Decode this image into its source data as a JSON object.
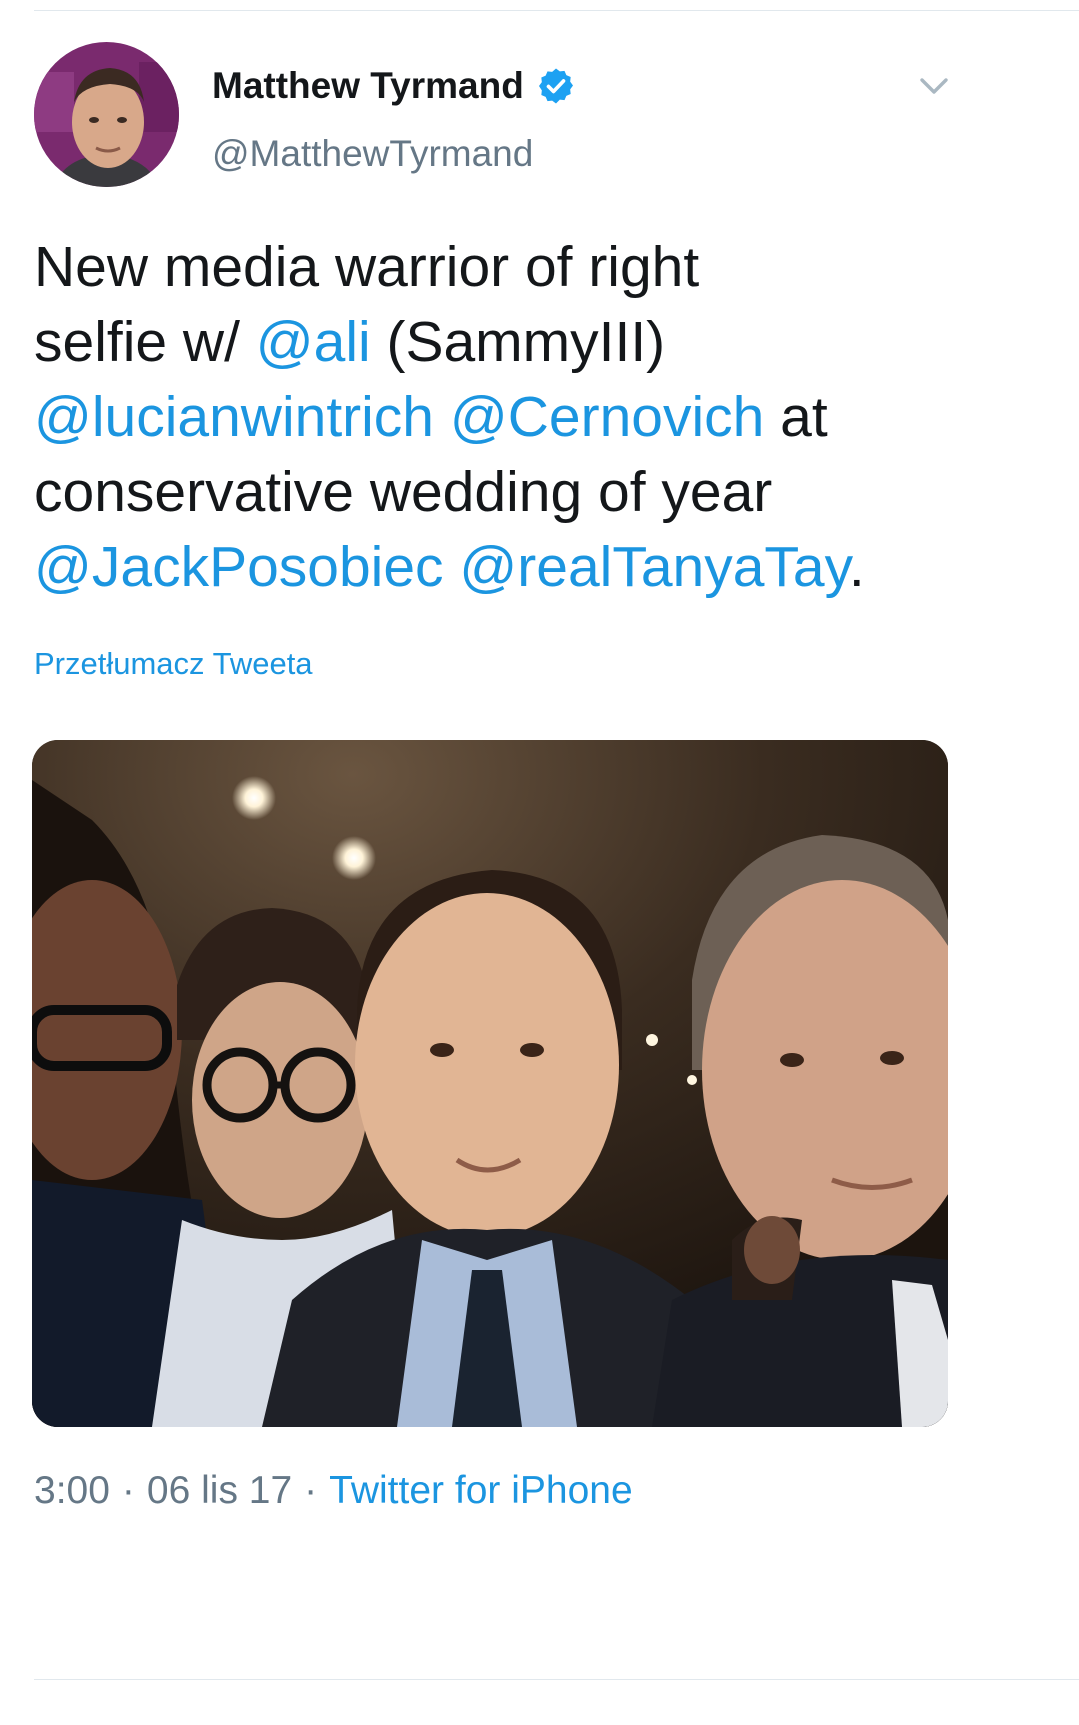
{
  "tweet": {
    "author": {
      "display_name": "Matthew Tyrmand",
      "handle": "@MatthewTyrmand",
      "verified": true,
      "avatar_icon": "profile-photo",
      "verified_icon": "verified-badge-icon"
    },
    "menu_icon": "chevron-down-icon",
    "text": {
      "line1": "New media warrior of right",
      "seg_selfie": "selfie w/ ",
      "mention_ali": "@ali",
      "seg_sammy": " (SammyIII)",
      "mention_lucian": "@lucianwintrich",
      "seg_space": " ",
      "mention_cernovich": "@Cernovich",
      "seg_at": " at",
      "line4": "conservative wedding of year",
      "mention_jack": "@JackPosobiec",
      "mention_tanya": "@realTanyaTay",
      "seg_period": "."
    },
    "translate_label": "Przetłumacz Tweeta",
    "media_type": "photo",
    "meta": {
      "time": "3:00",
      "separator": "·",
      "date": "06 lis 17",
      "source": "Twitter for iPhone"
    }
  },
  "colors": {
    "link": "#1b95e0",
    "text": "#14171a",
    "muted": "#657786",
    "verified": "#1da1f2",
    "divider": "#e1e8ed"
  }
}
